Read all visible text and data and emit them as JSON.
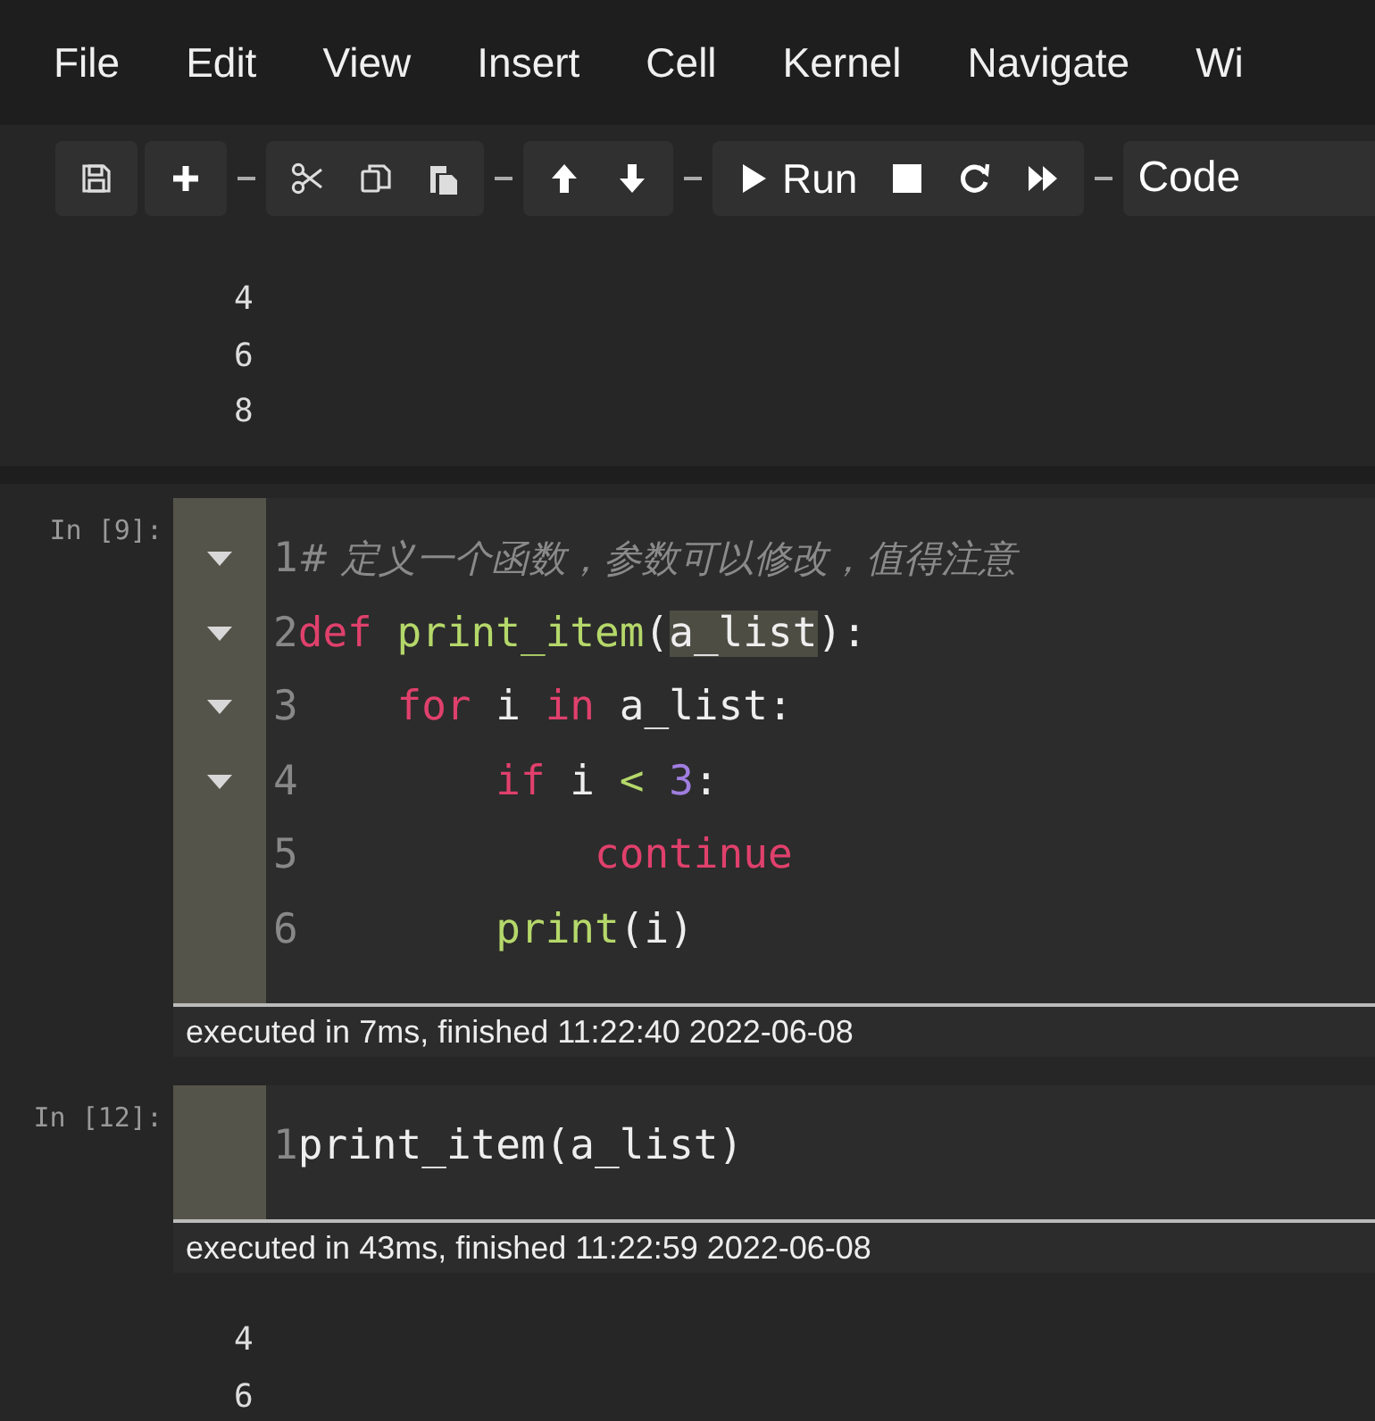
{
  "menu": [
    "File",
    "Edit",
    "View",
    "Insert",
    "Cell",
    "Kernel",
    "Navigate",
    "Wi"
  ],
  "toolbar": {
    "groups": [
      [
        {
          "kind": "save"
        }
      ],
      [
        {
          "kind": "plus"
        }
      ],
      [
        {
          "kind": "cut"
        },
        {
          "kind": "copy"
        },
        {
          "kind": "paste"
        }
      ],
      [
        {
          "kind": "up"
        },
        {
          "kind": "down"
        }
      ],
      [
        {
          "kind": "run",
          "label": "Run"
        },
        {
          "kind": "stop"
        },
        {
          "kind": "restart"
        },
        {
          "kind": "fastforward"
        }
      ]
    ],
    "cell_type": "Code"
  },
  "cells": [
    {
      "kind": "output",
      "lines": [
        "4",
        "6",
        "8"
      ]
    },
    {
      "kind": "code",
      "prompt": "In [9]:",
      "lines": [
        {
          "number": "1",
          "fold": true,
          "tokens": [
            {
              "kind": "comment",
              "text": "# 定义一个函数，参数可以修改，值得注意"
            }
          ]
        },
        {
          "number": "2",
          "fold": true,
          "tokens": [
            {
              "kind": "keyword",
              "text": "def "
            },
            {
              "kind": "function",
              "text": "print_item"
            },
            {
              "kind": "plain",
              "text": "("
            },
            {
              "kind": "plain",
              "text": "a_list",
              "highlighted": true
            },
            {
              "kind": "plain",
              "text": "):"
            }
          ],
          "children": [
            {
              "number": "3",
              "fold": true,
              "tokens": [
                {
                  "kind": "keyword",
                  "text": "for"
                },
                {
                  "kind": "plain",
                  "text": " i "
                },
                {
                  "kind": "keyword",
                  "text": "in"
                },
                {
                  "kind": "plain",
                  "text": " a_list:"
                }
              ],
              "children": [
                {
                  "number": "4",
                  "fold": true,
                  "tokens": [
                    {
                      "kind": "keyword",
                      "text": "if"
                    },
                    {
                      "kind": "plain",
                      "text": " i "
                    },
                    {
                      "kind": "operator",
                      "text": "< "
                    },
                    {
                      "kind": "number",
                      "text": "3"
                    },
                    {
                      "kind": "plain",
                      "text": ":"
                    }
                  ],
                  "children": [
                    {
                      "number": "5",
                      "fold": false,
                      "tokens": [
                        {
                          "kind": "keyword",
                          "text": "continue"
                        }
                      ]
                    }
                  ]
                },
                {
                  "number": "6",
                  "fold": false,
                  "tokens": [
                    {
                      "kind": "function",
                      "text": "print"
                    },
                    {
                      "kind": "plain",
                      "text": "(i)"
                    }
                  ]
                }
              ]
            }
          ]
        }
      ],
      "timing": "executed in 7ms, finished 11:22:40 2022-06-08"
    },
    {
      "kind": "code",
      "prompt": "In [12]:",
      "lines": [
        {
          "number": "1",
          "fold": false,
          "tokens": [
            {
              "kind": "plain",
              "text": "print_item(a_list)"
            }
          ]
        }
      ],
      "timing": "executed in 43ms, finished 11:22:59 2022-06-08"
    },
    {
      "kind": "output",
      "lines": [
        "4",
        "6"
      ]
    }
  ]
}
